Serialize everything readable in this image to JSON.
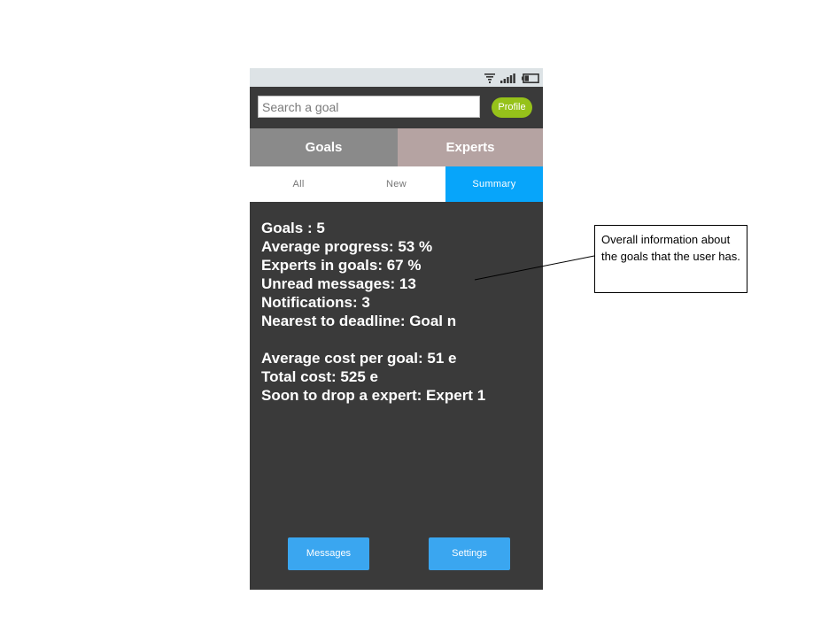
{
  "status_bar": {
    "icons": [
      "wifi-icon",
      "signal-icon",
      "battery-icon"
    ]
  },
  "search": {
    "placeholder": "Search a goal",
    "value": ""
  },
  "profile_button": {
    "label": "Profile"
  },
  "main_tabs": [
    {
      "label": "Goals"
    },
    {
      "label": "Experts"
    }
  ],
  "sub_tabs": [
    {
      "label": "All"
    },
    {
      "label": "New"
    },
    {
      "label": "Summary",
      "active": true
    }
  ],
  "summary": {
    "goals": "Goals : 5",
    "average_progress": "Average progress: 53 %",
    "experts_in_goals": "Experts in goals: 67 %",
    "unread_messages": "Unread messages: 13",
    "notifications": "Notifications: 3",
    "nearest_deadline": "Nearest to deadline: Goal n",
    "average_cost": "Average cost per goal: 51 e",
    "total_cost": "Total cost: 525 e",
    "soon_to_drop": "Soon to drop a expert: Expert 1"
  },
  "buttons": {
    "messages": "Messages",
    "settings": "Settings"
  },
  "annotation": {
    "text": "Overall information about the goals that the user has."
  },
  "colors": {
    "background": "#3a3a3a",
    "status_bar": "#dde3e6",
    "profile": "#96c21a",
    "tab_goals": "#8a8a8a",
    "tab_experts": "#b5a3a2",
    "summary_tab_active": "#07a5fa",
    "bottom_buttons": "#3aa6f0"
  }
}
